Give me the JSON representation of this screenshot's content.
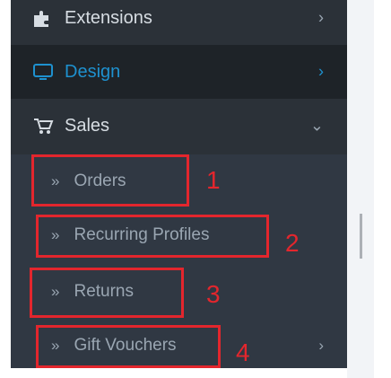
{
  "menu": {
    "items": [
      {
        "label": "Extensions",
        "icon": "puzzle-icon",
        "arrow": "›"
      },
      {
        "label": "Design",
        "icon": "monitor-icon",
        "arrow": "›"
      },
      {
        "label": "Sales",
        "icon": "cart-icon",
        "arrow": "⌄"
      }
    ],
    "sub_items": [
      {
        "label": "Orders"
      },
      {
        "label": "Recurring Profiles"
      },
      {
        "label": "Returns"
      },
      {
        "label": "Gift Vouchers",
        "arrow": "›"
      }
    ]
  },
  "annotations": [
    "1",
    "2",
    "3",
    "4"
  ],
  "colors": {
    "sidebar_bg": "#2b3138",
    "active_bg": "#1e2328",
    "accent": "#1e91cf",
    "annotation_red": "#e3262d"
  }
}
